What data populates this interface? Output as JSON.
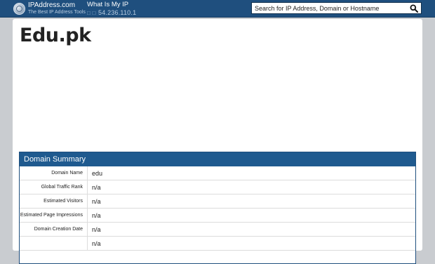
{
  "header": {
    "logo_name": "IPAddress.com",
    "logo_tagline": "The Best IP Address Tools",
    "my_ip_label": "What Is My IP",
    "my_ip_value": "54.236.110.1",
    "search_placeholder": "Search for IP Address, Domain or Hostname"
  },
  "page": {
    "title": "Edu.pk"
  },
  "domain_summary": {
    "heading": "Domain Summary",
    "rows": [
      {
        "label": "Domain Name",
        "value": "edu"
      },
      {
        "label": "Global Traffic Rank",
        "value": "n/a"
      },
      {
        "label": "Estimated Visitors",
        "value": "n/a"
      },
      {
        "label": "Estimated Page Impressions",
        "value": "n/a"
      },
      {
        "label": "Domain Creation Date",
        "value": "n/a"
      },
      {
        "label": "",
        "value": "n/a"
      }
    ]
  },
  "colors": {
    "header_bg": "#1f4f7e",
    "panel_head_bg": "#1f5a8f",
    "page_bg": "#c9ccd0"
  }
}
